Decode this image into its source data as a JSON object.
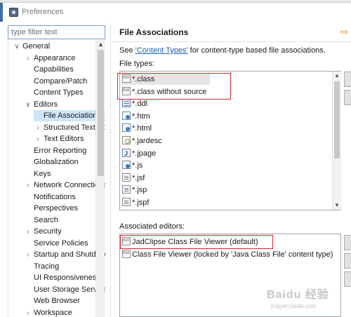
{
  "window": {
    "title": "Preferences"
  },
  "filter": {
    "placeholder": "type filter text"
  },
  "tree": {
    "items": [
      {
        "label": "General",
        "toggle": "v",
        "level": 0
      },
      {
        "label": "Appearance",
        "toggle": ">",
        "level": 1
      },
      {
        "label": "Capabilities",
        "toggle": "",
        "level": 1
      },
      {
        "label": "Compare/Patch",
        "toggle": "",
        "level": 1
      },
      {
        "label": "Content Types",
        "toggle": "",
        "level": 1
      },
      {
        "label": "Editors",
        "toggle": "v",
        "level": 1
      },
      {
        "label": "File Associations",
        "toggle": "",
        "level": 2,
        "selected": true
      },
      {
        "label": "Structured Text Editors",
        "toggle": ">",
        "level": 2
      },
      {
        "label": "Text Editors",
        "toggle": ">",
        "level": 2
      },
      {
        "label": "Error Reporting",
        "toggle": "",
        "level": 1
      },
      {
        "label": "Globalization",
        "toggle": "",
        "level": 1
      },
      {
        "label": "Keys",
        "toggle": "",
        "level": 1
      },
      {
        "label": "Network Connections",
        "toggle": ">",
        "level": 1
      },
      {
        "label": "Notifications",
        "toggle": "",
        "level": 1
      },
      {
        "label": "Perspectives",
        "toggle": "",
        "level": 1
      },
      {
        "label": "Search",
        "toggle": "",
        "level": 1
      },
      {
        "label": "Security",
        "toggle": ">",
        "level": 1
      },
      {
        "label": "Service Policies",
        "toggle": "",
        "level": 1
      },
      {
        "label": "Startup and Shutdown",
        "toggle": ">",
        "level": 1
      },
      {
        "label": "Tracing",
        "toggle": "",
        "level": 1
      },
      {
        "label": "UI Responsiveness",
        "toggle": "",
        "level": 1
      },
      {
        "label": "User Storage Service",
        "toggle": "",
        "level": 1
      },
      {
        "label": "Web Browser",
        "toggle": "",
        "level": 1
      },
      {
        "label": "Workspace",
        "toggle": ">",
        "level": 1
      }
    ]
  },
  "page": {
    "title": "File Associations",
    "see_prefix": "See ",
    "see_link": "'Content Types'",
    "see_suffix": " for content-type based file associations.",
    "file_types_label": "File types:",
    "associated_label": "Associated editors:"
  },
  "file_types": [
    {
      "label": "*.class",
      "icon": "binary-file-icon",
      "kind": "bin",
      "selected": true
    },
    {
      "label": "*.class without source",
      "icon": "binary-file-icon",
      "kind": "bin"
    },
    {
      "label": "*.ddl",
      "icon": "ddl-file-icon",
      "kind": "ddl"
    },
    {
      "label": "*.htm",
      "icon": "web-file-icon",
      "kind": "web"
    },
    {
      "label": "*.html",
      "icon": "web-file-icon",
      "kind": "web"
    },
    {
      "label": "*.jardesc",
      "icon": "jar-file-icon",
      "kind": "jar"
    },
    {
      "label": "*.jpage",
      "icon": "java-page-icon",
      "kind": "js"
    },
    {
      "label": "*.js",
      "icon": "javascript-file-icon",
      "kind": "web"
    },
    {
      "label": "*.jsf",
      "icon": "text-file-icon",
      "kind": "txt"
    },
    {
      "label": "*.jsp",
      "icon": "text-file-icon",
      "kind": "txt"
    },
    {
      "label": "*.jspf",
      "icon": "text-file-icon",
      "kind": "txt"
    }
  ],
  "editors": [
    {
      "label": "JadClipse Class File Viewer (default)",
      "icon": "class-viewer-icon"
    },
    {
      "label": "Class File Viewer (locked by 'Java Class File' content type)",
      "icon": "class-viewer-icon"
    }
  ],
  "watermark": {
    "logo": "Baidu 经验",
    "sub": "jingyan.baidu.com"
  },
  "colors": {
    "highlight_box": "#e0262c",
    "link": "#1a5fb4",
    "selection": "#cde6f7"
  }
}
